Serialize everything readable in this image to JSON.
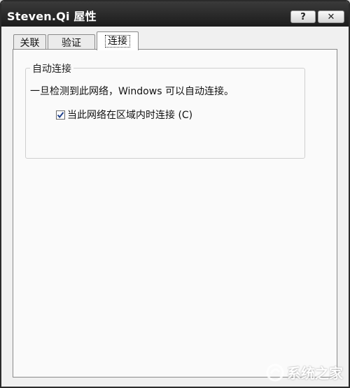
{
  "window": {
    "title": "Steven.Qi 屋性",
    "help_label": "?",
    "close_label": "✕"
  },
  "tabs": [
    {
      "label": "关联"
    },
    {
      "label": "验证"
    },
    {
      "label": "连接",
      "selected": true
    }
  ],
  "group": {
    "title": "自动连接",
    "description": "一旦检测到此网络，Windows 可以自动连接。",
    "checkbox_label": "当此网络在区域内时连接 (C)",
    "checkbox_checked": true
  },
  "watermark": {
    "text": "系统之家"
  },
  "colors": {
    "titlebar": "#1c1c1c",
    "panel": "#fafafa"
  },
  "icons": {
    "help": "question-mark",
    "close": "x-close",
    "check": "checkmark",
    "watermark": "system-home-logo"
  }
}
